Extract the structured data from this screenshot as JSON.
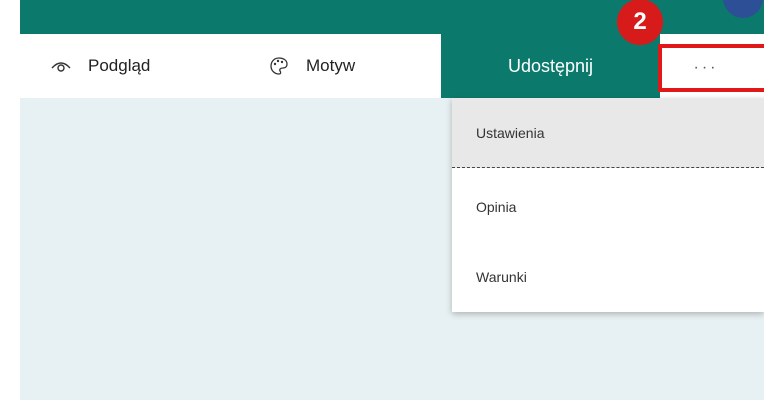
{
  "toolbar": {
    "preview_label": "Podgląd",
    "preview_icon": "eye-icon",
    "theme_label": "Motyw",
    "theme_icon": "palette-icon",
    "share_label": "Udostępnij",
    "more_label": "···",
    "more_icon": "more-options-icon"
  },
  "annotation": {
    "step": "2"
  },
  "menu": {
    "items": [
      {
        "label": "Ustawienia"
      },
      {
        "label": "Opinia"
      },
      {
        "label": "Warunki"
      }
    ]
  },
  "colors": {
    "brand": "#0b7a6c",
    "highlight": "#e01818",
    "canvas": "#e7f0f2"
  }
}
